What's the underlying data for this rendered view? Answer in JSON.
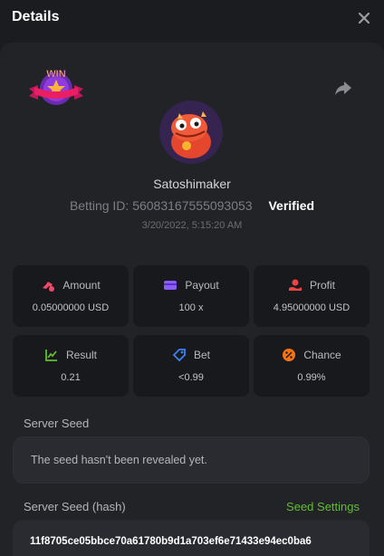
{
  "header": {
    "title": "Details",
    "close_icon": "close-icon"
  },
  "bet": {
    "username": "Satoshimaker",
    "betting_id_label": "Betting ID:",
    "betting_id": "56083167555093053",
    "verified": "Verified",
    "datetime": "3/20/2022, 5:15:20 AM",
    "badge_text": "WIN"
  },
  "stats": [
    {
      "label": "Amount",
      "value": "0.05000000 USD",
      "icon": "coins-icon",
      "color": "#ef4a6a"
    },
    {
      "label": "Payout",
      "value": "100 x",
      "icon": "wallet-icon",
      "color": "#8b5cf6"
    },
    {
      "label": "Profit",
      "value": "4.95000000 USD",
      "icon": "hand-coin-icon",
      "color": "#ef4444"
    },
    {
      "label": "Result",
      "value": "0.21",
      "icon": "chart-icon",
      "color": "#5fbf2f"
    },
    {
      "label": "Bet",
      "value": "<0.99",
      "icon": "tag-icon",
      "color": "#3b82f6"
    },
    {
      "label": "Chance",
      "value": "0.99%",
      "icon": "percent-icon",
      "color": "#f97316"
    }
  ],
  "server_seed": {
    "label": "Server Seed",
    "value": "The seed hasn't been revealed yet."
  },
  "server_seed_hash": {
    "label": "Server Seed (hash)",
    "settings_link": "Seed Settings",
    "value": "11f8705ce05bbce70a61780b9d1a703ef6e71433e94ec0ba6"
  },
  "colors": {
    "accent_green": "#5fbf2f",
    "background": "#1b1c1f",
    "panel": "#222327"
  }
}
